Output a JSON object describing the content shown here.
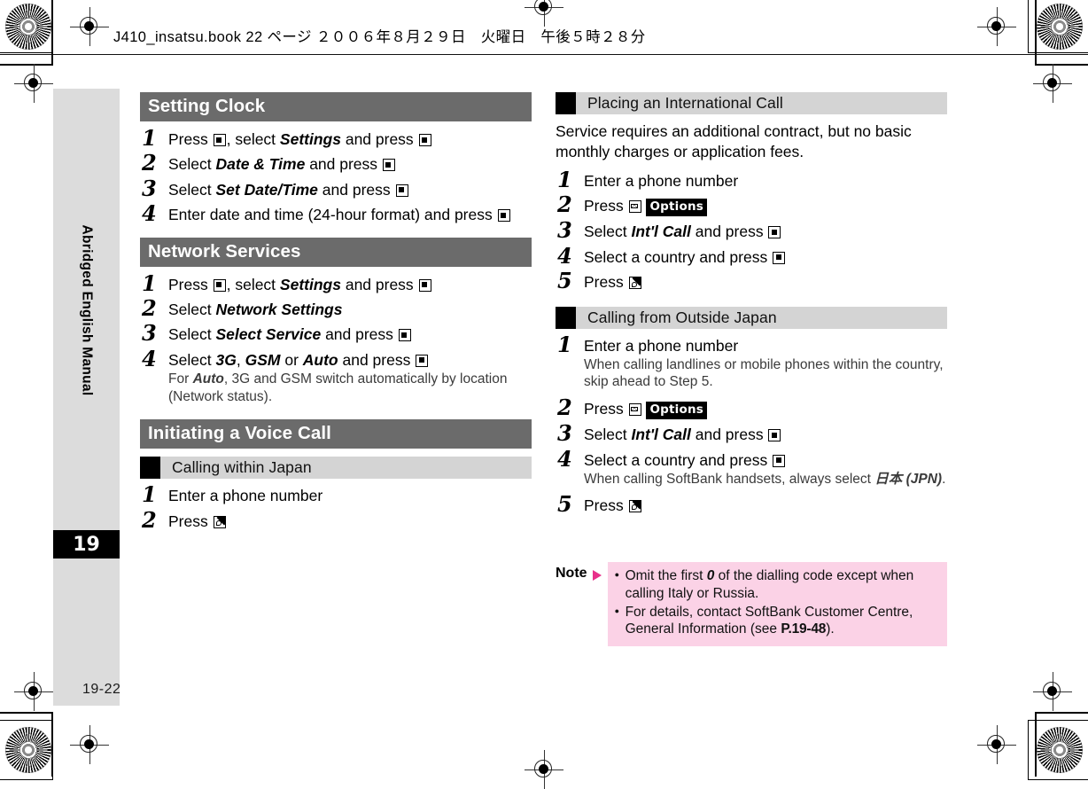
{
  "print_header": "J410_insatsu.book  22 ページ  ２００６年８月２９日　火曜日　午後５時２８分",
  "side_tab": {
    "label": "Abridged English Manual",
    "chapter_number": "19"
  },
  "folio": "19-22",
  "left_column": {
    "sections": [
      {
        "title": "Setting Clock",
        "steps": [
          {
            "num": "1",
            "pre": "Press ",
            "mid": ", select ",
            "em": "Settings",
            "post": " and press "
          },
          {
            "num": "2",
            "pre": "Select ",
            "em": "Date & Time",
            "post": " and press "
          },
          {
            "num": "3",
            "pre": "Select ",
            "em": "Set Date/Time",
            "post": " and press "
          },
          {
            "num": "4",
            "pre": "Enter date and time (24-hour format) and press "
          }
        ]
      },
      {
        "title": "Network Services",
        "steps": [
          {
            "num": "1",
            "pre": "Press ",
            "mid": ", select ",
            "em": "Settings",
            "post": " and press "
          },
          {
            "num": "2",
            "pre": "Select ",
            "em": "Network Settings",
            "post": ""
          },
          {
            "num": "3",
            "pre": "Select ",
            "em": "Select Service",
            "post": " and press "
          },
          {
            "num": "4",
            "pre": "Select ",
            "em": "3G",
            "mid2": ", ",
            "em2": "GSM",
            "mid3": " or ",
            "em3": "Auto",
            "post": " and press ",
            "note_pre": "For ",
            "note_em": "Auto",
            "note_post": ", 3G and GSM switch automatically by location (Network status)."
          }
        ]
      },
      {
        "title": "Initiating a Voice Call",
        "subsection": "Calling within Japan",
        "sub_steps": [
          {
            "num": "1",
            "pre": "Enter a phone number"
          },
          {
            "num": "2",
            "pre": "Press "
          }
        ]
      }
    ]
  },
  "right_column": {
    "subsection_1": {
      "title": "Placing an International Call",
      "lead": "Service requires an additional contract, but no basic monthly charges or application fees.",
      "steps": [
        {
          "num": "1",
          "pre": "Enter a phone number"
        },
        {
          "num": "2",
          "pre": "Press ",
          "softkey": "Options"
        },
        {
          "num": "3",
          "pre": "Select ",
          "em": "Int'l Call",
          "post": " and press "
        },
        {
          "num": "4",
          "pre": "Select a country and press "
        },
        {
          "num": "5",
          "pre": "Press "
        }
      ]
    },
    "subsection_2": {
      "title": "Calling from Outside Japan",
      "steps": [
        {
          "num": "1",
          "pre": "Enter a phone number",
          "note_post": "When calling landlines or mobile phones within the country, skip ahead to Step 5."
        },
        {
          "num": "2",
          "pre": "Press ",
          "softkey": "Options"
        },
        {
          "num": "3",
          "pre": "Select ",
          "em": "Int'l Call",
          "post": " and press "
        },
        {
          "num": "4",
          "pre": "Select a country and press ",
          "note_post": "When calling SoftBank handsets, always select ",
          "note_em": "日本 (JPN)",
          "note_tail": "."
        },
        {
          "num": "5",
          "pre": "Press "
        }
      ]
    },
    "note": {
      "label": "Note",
      "items": [
        {
          "pre": "Omit the first ",
          "em": "0",
          "post": " of the dialling code except when calling Italy or Russia."
        },
        {
          "pre": "For details, contact SoftBank Customer Centre, General Information (see ",
          "ref": "P.19-48",
          "post": ")."
        }
      ]
    }
  },
  "colors": {
    "section_bar": "#6b6b6b",
    "subsection_bar": "#d4d4d4",
    "note_background": "#fbd2e6",
    "note_marker": "#e8308a",
    "side_tab": "#dcdcdc"
  }
}
